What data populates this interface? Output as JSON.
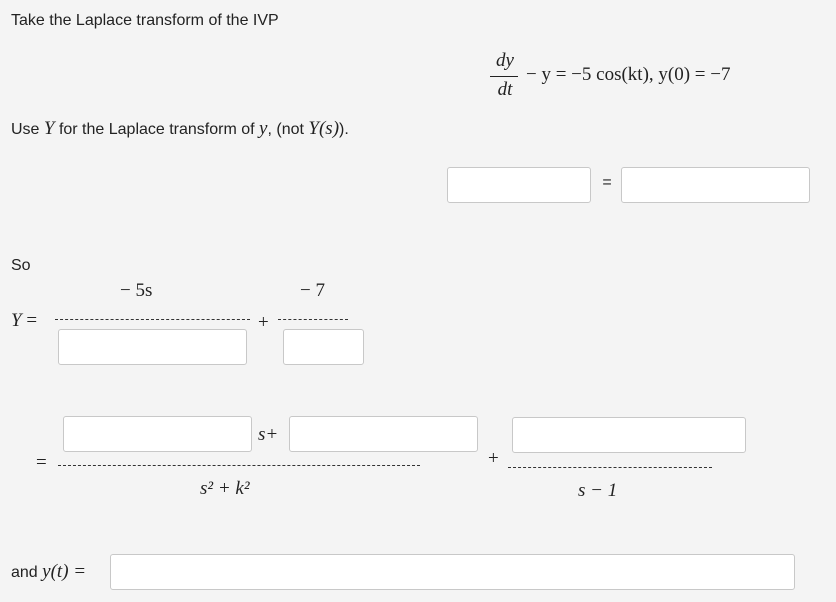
{
  "intro": {
    "prompt": "Take the Laplace transform of the IVP"
  },
  "ode": {
    "numerator": "dy",
    "denominator": "dt",
    "rest": "− y = −5 cos(kt), y(0) = −7"
  },
  "instruction": {
    "prefix": "Use",
    "y_cap": "Y",
    "middle": "for the Laplace transform of",
    "y_lower": "y",
    "suffix_a": ", (not",
    "y_of_s": "Y(s)",
    "suffix_b": ")."
  },
  "transform_eq": {
    "lhs_value": "",
    "equals": "=",
    "rhs_value": ""
  },
  "so_label": "So",
  "y_def": {
    "lhs": "Y =",
    "term1_num": "− 5s",
    "term1_den_value": "",
    "plus": "+",
    "term2_num": "− 7",
    "term2_den_value": ""
  },
  "partial": {
    "equals": "=",
    "coef_a_value": "",
    "s_plus": "s+",
    "coef_b_value": "",
    "den1": "s² + k²",
    "plus": "+",
    "num2_value": "",
    "den2": "s − 1"
  },
  "solution": {
    "label_text": "and",
    "label_math": "y(t) =",
    "value": ""
  }
}
